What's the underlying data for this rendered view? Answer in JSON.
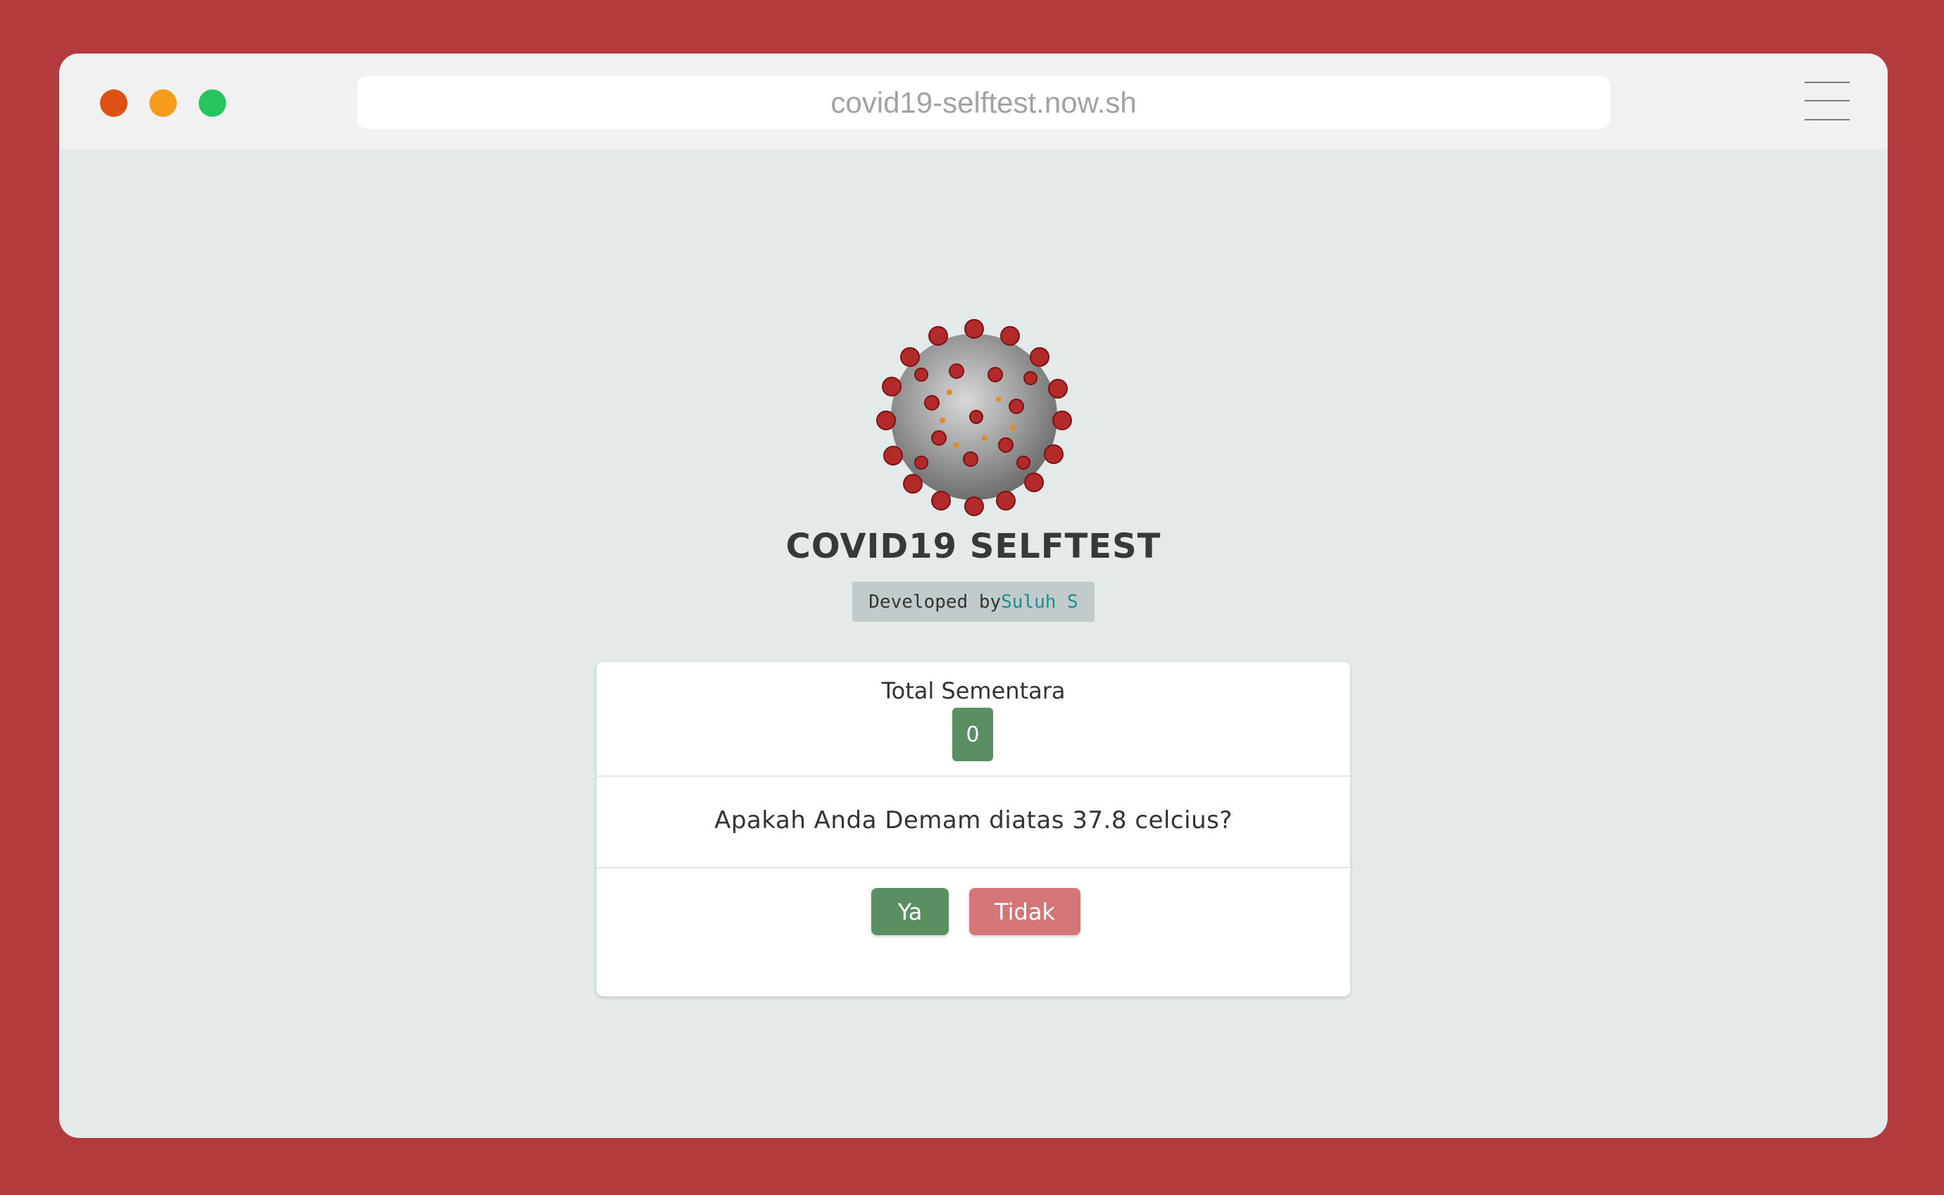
{
  "browser": {
    "url": "covid19-selftest.now.sh"
  },
  "header": {
    "title": "COVID19 SELFTEST",
    "developed_by": "Developed by",
    "author": "Suluh S"
  },
  "card": {
    "total_label": "Total Sementara",
    "total_value": "0",
    "question": "Apakah Anda Demam diatas 37.8 celcius?",
    "yes_label": "Ya",
    "no_label": "Tidak"
  },
  "colors": {
    "background": "#b33b3e",
    "green": "#5a8f62",
    "red_button": "#d47677",
    "author_link": "#1d8c8c"
  }
}
